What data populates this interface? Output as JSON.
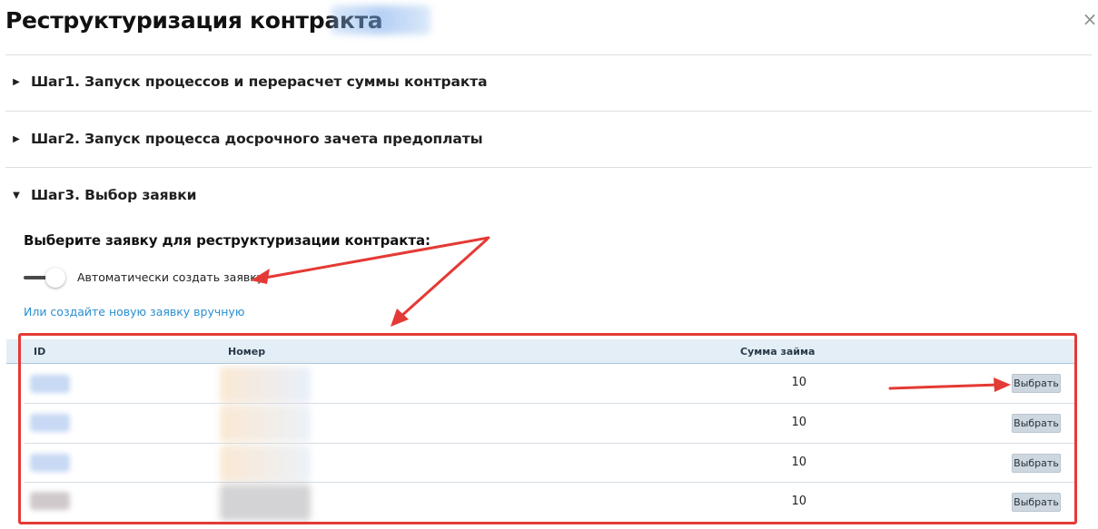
{
  "dialog": {
    "title": "Реструктуризация контракта",
    "close_glyph": "×"
  },
  "steps": [
    {
      "label": "Шаг1. Запуск процессов и перерасчет суммы контракта",
      "expanded": false
    },
    {
      "label": "Шаг2. Запуск процесса досрочного зачета предоплаты",
      "expanded": false
    },
    {
      "label": "Шаг3. Выбор заявки",
      "expanded": true
    }
  ],
  "step3": {
    "heading": "Выберите заявку для реструктуризации контракта:",
    "toggle_label": "Автоматически создать заявку",
    "toggle_on": false,
    "manual_link": "Или создайте новую заявку вручную"
  },
  "table": {
    "columns": [
      "ID",
      "Номер",
      "Сумма займа"
    ],
    "rows": [
      {
        "amount": "10",
        "button": "Выбрать"
      },
      {
        "amount": "10",
        "button": "Выбрать"
      },
      {
        "amount": "10",
        "button": "Выбрать"
      },
      {
        "amount": "10",
        "button": "Выбрать"
      }
    ]
  },
  "colors": {
    "annotation_red": "#e43a35",
    "link_blue": "#2a8fd0",
    "header_bg": "#e3eef6"
  }
}
